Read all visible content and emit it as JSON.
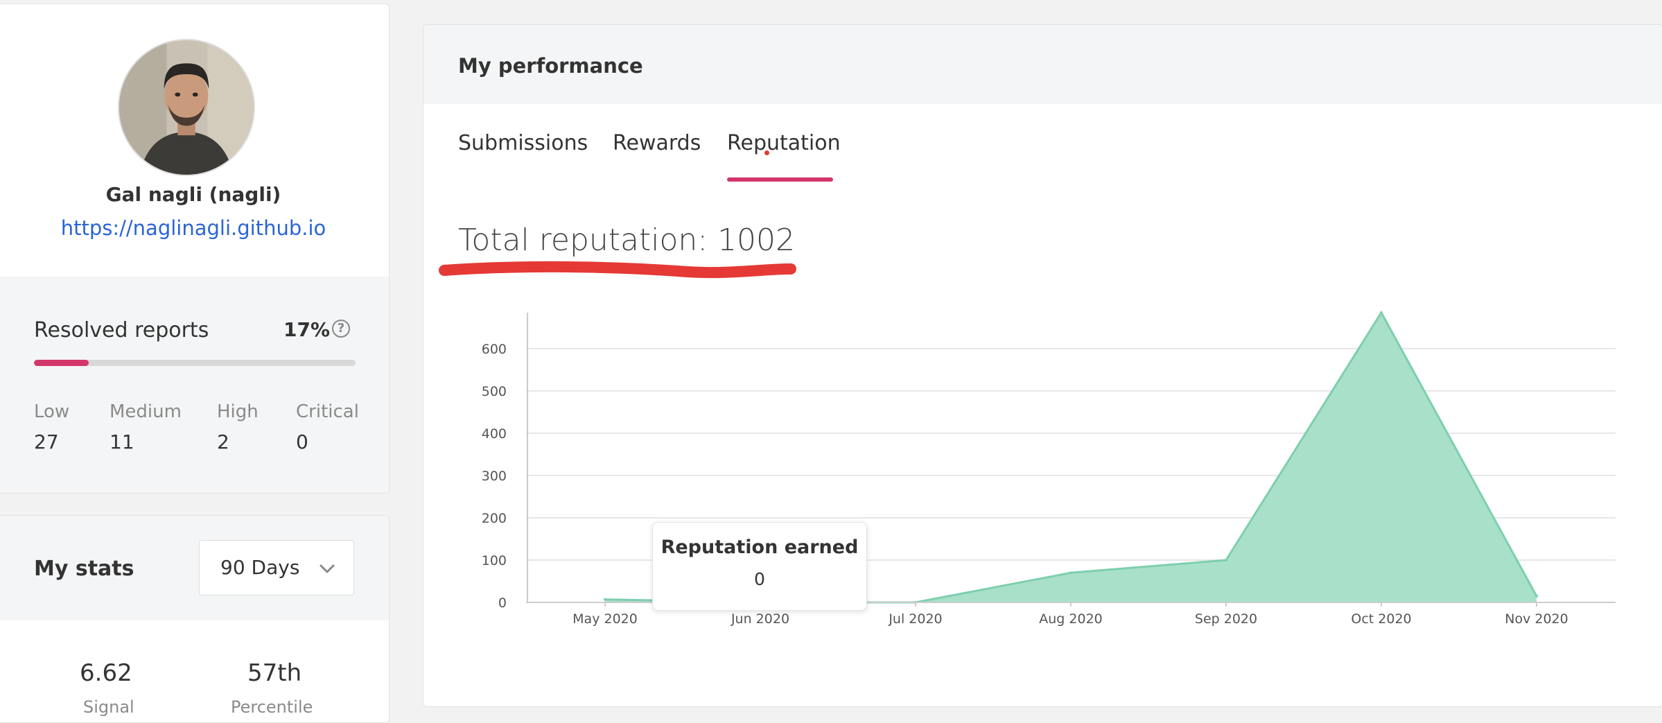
{
  "profile": {
    "name": "Gal nagli (nagli)",
    "link": "https://naglinagli.github.io",
    "resolved_label": "Resolved reports",
    "resolved_percent_text": "17%",
    "resolved_fraction": 0.17,
    "help_glyph": "?",
    "severity": [
      {
        "label": "Low",
        "value": "27"
      },
      {
        "label": "Medium",
        "value": "11"
      },
      {
        "label": "High",
        "value": "2"
      },
      {
        "label": "Critical",
        "value": "0"
      }
    ]
  },
  "stats": {
    "title": "My stats",
    "period": "90 Days",
    "items": [
      {
        "value": "6.62",
        "label": "Signal"
      },
      {
        "value": "57th",
        "label": "Percentile"
      }
    ]
  },
  "performance": {
    "title": "My performance",
    "tabs": [
      "Submissions",
      "Rewards",
      "Reputation"
    ],
    "active_tab": "Reputation",
    "total_reputation": "Total reputation: 1002",
    "tooltip": {
      "title": "Reputation earned",
      "value": "0"
    }
  },
  "colors": {
    "accent": "#d33669",
    "link": "#2a64d8",
    "area_fill": "#a9e0c9",
    "area_stroke": "#7dcfae",
    "annotation": "#e53935"
  },
  "icons": {
    "help": "question-circle-icon",
    "dropdown": "chevron-down-icon"
  },
  "chart_data": {
    "type": "area",
    "x": [
      "May 2020",
      "Jun 2020",
      "Jul 2020",
      "Aug 2020",
      "Sep 2020",
      "Oct 2020",
      "Nov 2020"
    ],
    "values": [
      7,
      0,
      0,
      70,
      100,
      685,
      15
    ],
    "yticks": [
      0,
      100,
      200,
      300,
      400,
      500,
      600
    ],
    "ylim": [
      0,
      685
    ],
    "grid": true,
    "legend": "none"
  }
}
